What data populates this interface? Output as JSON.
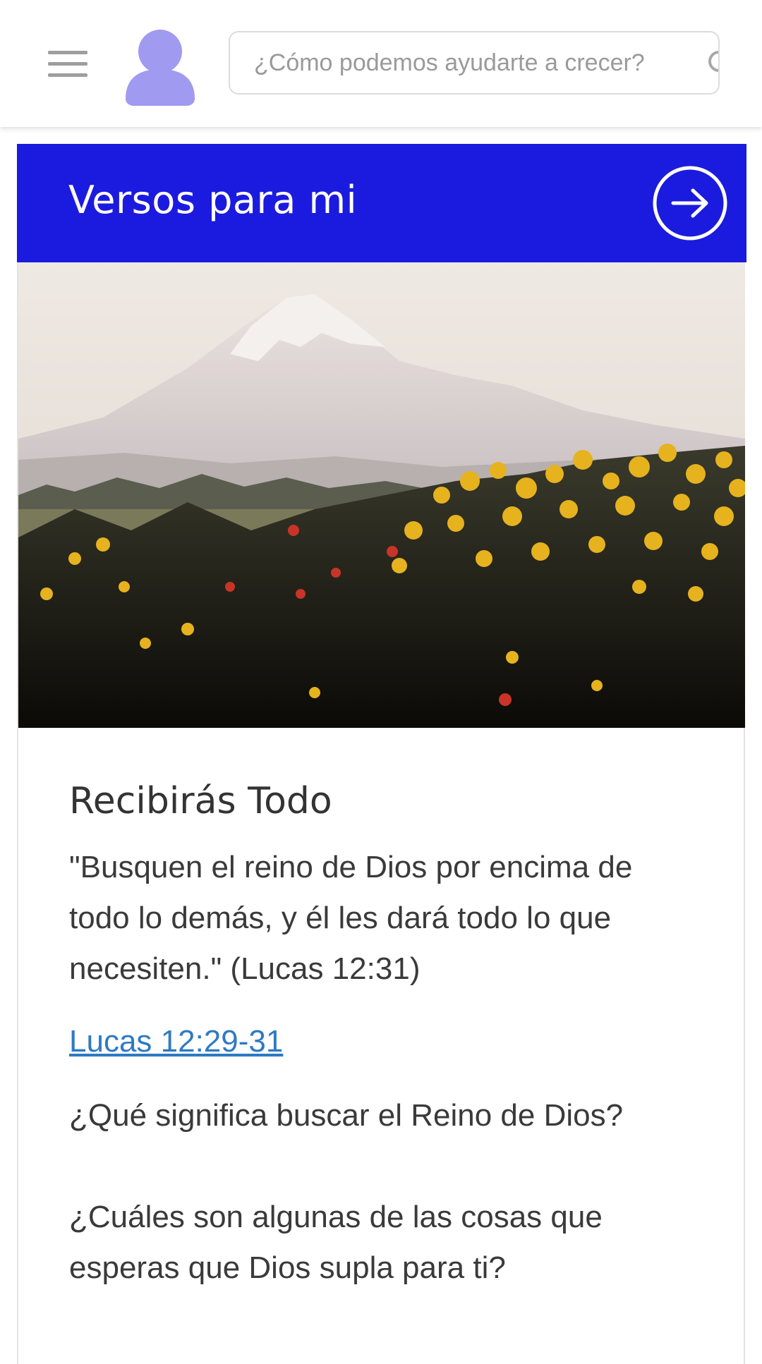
{
  "header": {
    "search_placeholder": "¿Cómo podemos ayudarte a crecer?",
    "menu_icon": "hamburger-menu-icon",
    "avatar_icon": "user-avatar-icon",
    "search_icon": "search-icon"
  },
  "card": {
    "title": "Versos para mi",
    "arrow_icon": "arrow-right-circle-icon",
    "image": "mountain-with-yellow-flowers-photo",
    "verse_title": "Recibirás Todo",
    "verse_text": "\"Busquen el reino de Dios por encima de todo lo demás, y él les dará todo lo que necesiten.\" (Lucas 12:31)",
    "verse_link": "Lucas 12:29-31",
    "questions": [
      "¿Qué significa buscar el Reino de Dios?",
      "¿Cuáles son algunas de las cosas que esperas que Dios supla para ti?"
    ]
  },
  "colors": {
    "header_blue": "#1b1bdf",
    "avatar_purple": "#a09af0",
    "link_blue": "#2f7ac2",
    "text_dark": "#3a3a3a"
  }
}
